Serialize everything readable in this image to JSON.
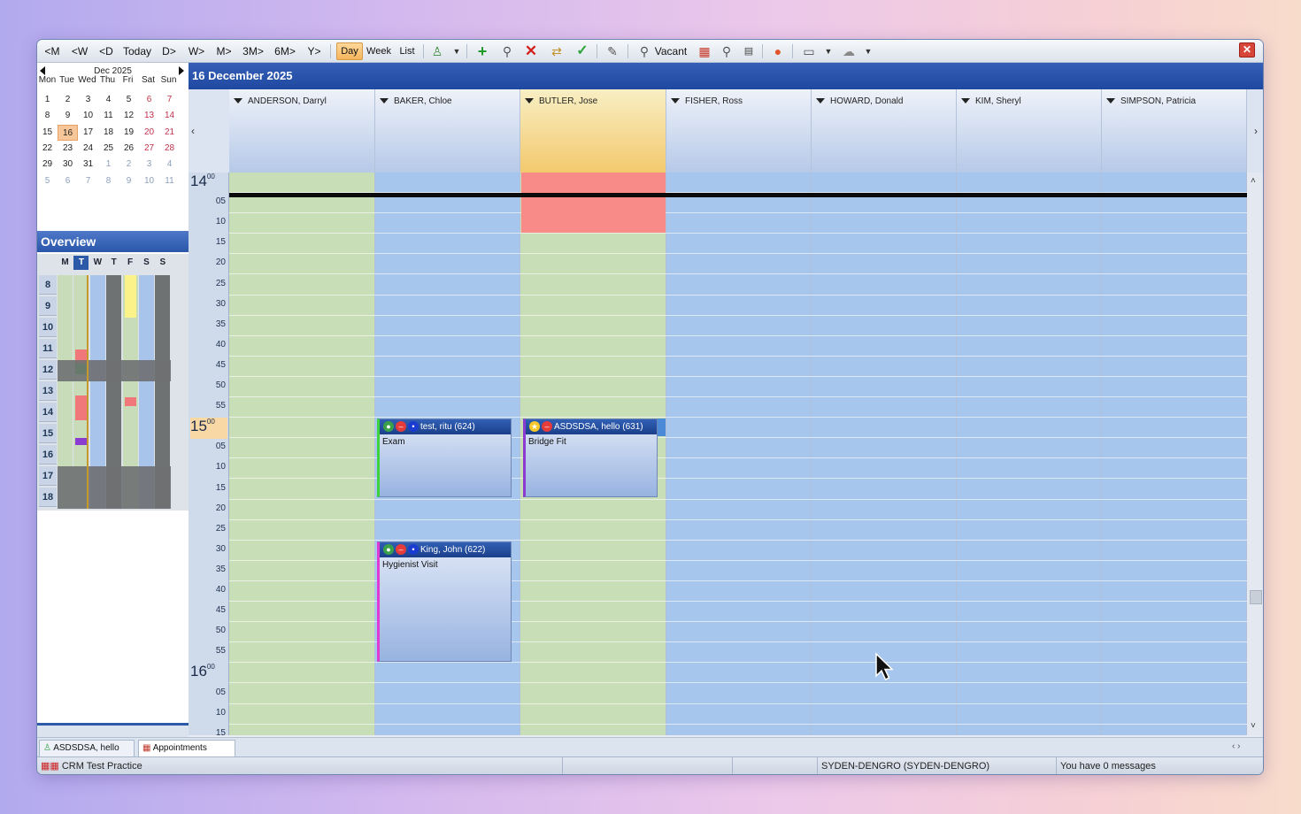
{
  "toolbar": {
    "nav": [
      "<M",
      "<W",
      "<D",
      "Today",
      "D>",
      "W>",
      "M>",
      "3M>",
      "6M>",
      "Y>"
    ],
    "views": [
      "Day",
      "Week",
      "List"
    ],
    "active_view": "Day",
    "vacant_label": "Vacant"
  },
  "mini_calendar": {
    "month_label": "Dec 2025",
    "dows": [
      "Mon",
      "Tue",
      "Wed",
      "Thu",
      "Fri",
      "Sat",
      "Sun"
    ],
    "weeks": [
      [
        "1",
        "2",
        "3",
        "4",
        "5",
        "6",
        "7"
      ],
      [
        "8",
        "9",
        "10",
        "11",
        "12",
        "13",
        "14"
      ],
      [
        "15",
        "16",
        "17",
        "18",
        "19",
        "20",
        "21"
      ],
      [
        "22",
        "23",
        "24",
        "25",
        "26",
        "27",
        "28"
      ],
      [
        "29",
        "30",
        "31",
        "1",
        "2",
        "3",
        "4"
      ],
      [
        "5",
        "6",
        "7",
        "8",
        "9",
        "10",
        "11"
      ]
    ],
    "today": "16"
  },
  "overview": {
    "title": "Overview",
    "dows": [
      "M",
      "T",
      "W",
      "T",
      "F",
      "S",
      "S"
    ],
    "hours": [
      "8",
      "9",
      "10",
      "11",
      "12",
      "13",
      "14",
      "15",
      "16",
      "17",
      "18"
    ]
  },
  "date_title": "16 December 2025",
  "columns": [
    "ANDERSON, Darryl",
    "BAKER, Chloe",
    "BUTLER, Jose",
    "FISHER, Ross",
    "HOWARD, Donald",
    "KIM, Sheryl",
    "SIMPSON, Patricia"
  ],
  "time_labels": {
    "hour14": "14",
    "hour15": "15",
    "hour16": "16",
    "min00": "00",
    "mins": [
      "05",
      "10",
      "15",
      "20",
      "25",
      "30",
      "35",
      "40",
      "45",
      "50",
      "55"
    ],
    "tail": [
      "05",
      "10",
      "15"
    ]
  },
  "appointments": [
    {
      "patient": "test, ritu (624)",
      "type": "Exam"
    },
    {
      "patient": "ASDSDSA, hello (631)",
      "type": "Bridge Fit"
    },
    {
      "patient": "King, John (622)",
      "type": "Hygienist Visit"
    }
  ],
  "tabs": [
    "ASDSDSA, hello",
    "Appointments"
  ],
  "status": {
    "practice": "CRM Test Practice",
    "server": "SYDEN-DENGRO (SYDEN-DENGRO)",
    "messages": "You have 0 messages"
  },
  "colors": {
    "accent": "#1f48a0",
    "available": "#c8dfb6",
    "busy": "#f88a87",
    "today": "#f7c79a"
  }
}
